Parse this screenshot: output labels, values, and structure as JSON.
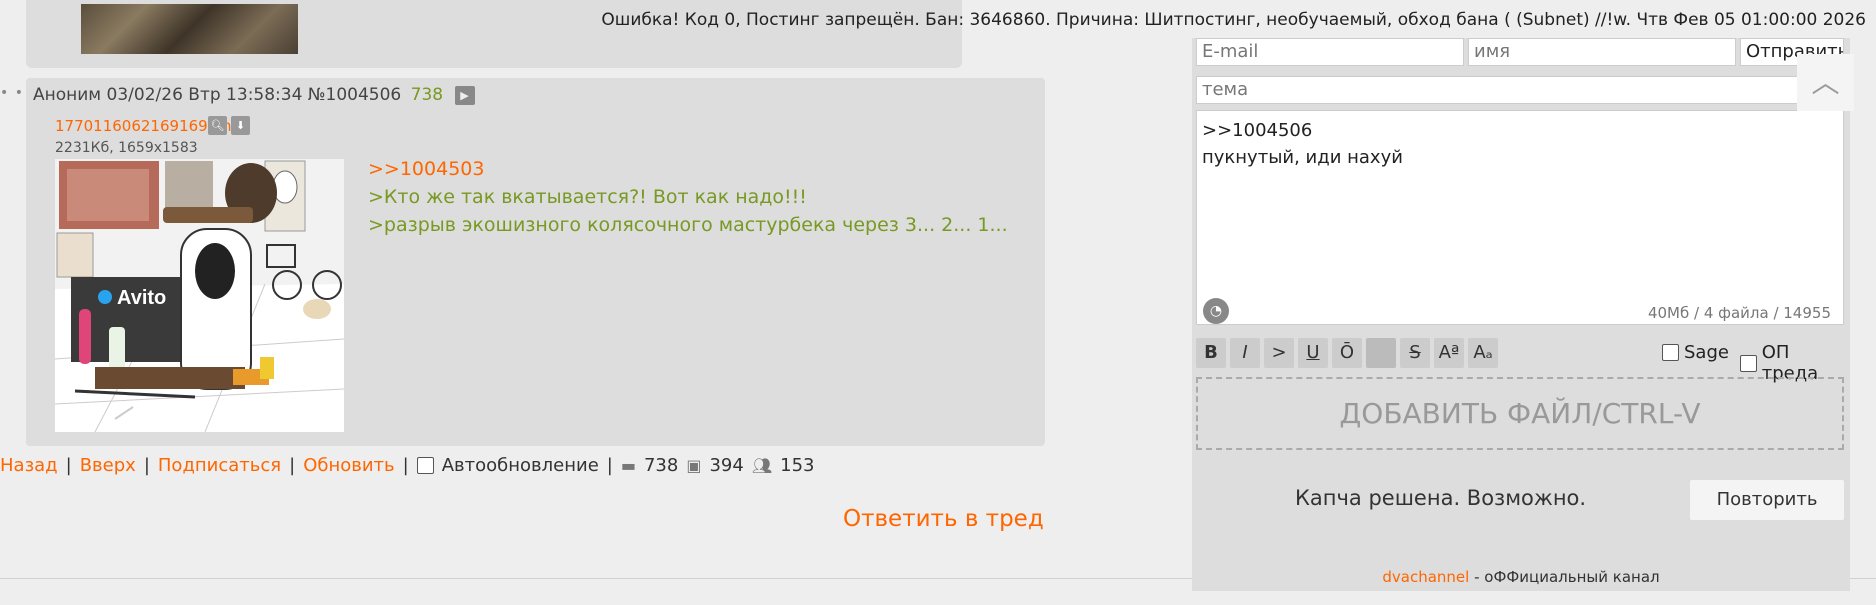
{
  "error_message": "Ошибка! Код 0, Постинг запрещён. Бан: 3646860. Причина: Шитпостинг, необучаемый, обход бана ( (Subnet) //!w. Чтв Фев 05 01:00:00 2026",
  "post": {
    "author": "Аноним",
    "datetime": "03/02/26 Втр 13:58:34",
    "number": "№1004506",
    "replies": "738",
    "file_name": "1770116062169169.png",
    "file_meta": "2231Кб, 1659x1583",
    "image_text": "Avito",
    "lines": [
      ">>1004503",
      ">Кто же так вкатывается?! Вот как надо!!!",
      ">разрыв экошизного колясочного мастурбека через 3... 2... 1..."
    ]
  },
  "thread_nav": {
    "back": "Назад",
    "up": "Вверх",
    "subscribe": "Подписаться",
    "refresh": "Обновить",
    "auto": "Автообновление",
    "posts": "738",
    "images": "394",
    "users": "153"
  },
  "reply_thread": "Ответить в тред",
  "form": {
    "email_placeholder": "E-mail",
    "name_placeholder": "имя",
    "submit": "Отправить",
    "subject_placeholder": "тема",
    "text_line1": ">>1004506",
    "text_line2": "пукнутый, иди нахуй",
    "counter": "40Мб / 4 файла / 14955",
    "format_buttons": [
      "B",
      "I",
      ">",
      "U",
      "Ō",
      "",
      "S",
      "Aª",
      "Aₐ"
    ],
    "sage": "Sage",
    "op": "ОП треда",
    "dropzone": "ДОБАВИТЬ ФАЙЛ/CTRL-V",
    "captcha_status": "Капча решена. Возможно.",
    "retry": "Повторить",
    "channel_link": "dvachannel",
    "channel_suffix": " - оФФициальный канал"
  },
  "colors": {
    "accent": "#ff6600",
    "quote": "#789922",
    "post_bg": "#dddddd",
    "page_bg": "#eeeeee"
  }
}
